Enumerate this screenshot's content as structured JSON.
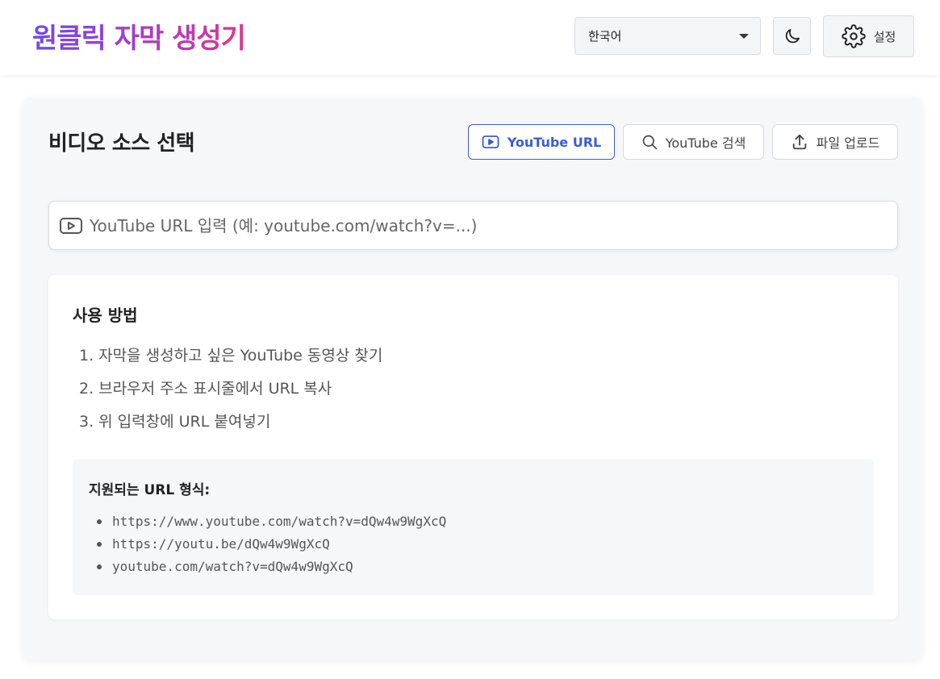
{
  "header": {
    "title": "원클릭 자막 생성기",
    "language_value": "한국어",
    "theme_icon": "moon-icon",
    "settings_label": "설정",
    "settings_icon": "gear-icon"
  },
  "source": {
    "title": "비디오 소스 선택",
    "tabs": [
      {
        "label": "YouTube URL",
        "icon": "play-icon",
        "active": true
      },
      {
        "label": "YouTube 검색",
        "icon": "search-icon",
        "active": false
      },
      {
        "label": "파일 업로드",
        "icon": "upload-icon",
        "active": false
      }
    ],
    "url_input": {
      "value": "",
      "placeholder": "YouTube URL 입력 (예: youtube.com/watch?v=...)"
    }
  },
  "howto": {
    "title": "사용 방법",
    "steps": [
      "1. 자막을 생성하고 싶은 YouTube 동영상 찾기",
      "2. 브라우저 주소 표시줄에서 URL 복사",
      "3. 위 입력창에 URL 붙여넣기"
    ],
    "formats_title": "지원되는 URL 형식:",
    "formats": [
      "https://www.youtube.com/watch?v=dQw4w9WgXcQ",
      "https://youtu.be/dQw4w9WgXcQ",
      "youtube.com/watch?v=dQw4w9WgXcQ"
    ]
  },
  "colors": {
    "accent": "#3b5bdb",
    "title_gradient_start": "#6d4be8",
    "title_gradient_end": "#e0368f"
  }
}
